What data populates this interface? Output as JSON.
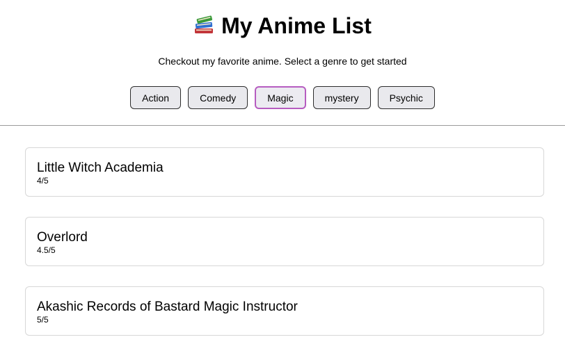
{
  "header": {
    "title": "My Anime List",
    "icon": "books-icon",
    "subtitle": "Checkout my favorite anime. Select a genre to get started"
  },
  "genres": {
    "selected": "Magic",
    "items": [
      {
        "label": "Action"
      },
      {
        "label": "Comedy"
      },
      {
        "label": "Magic"
      },
      {
        "label": "mystery"
      },
      {
        "label": "Psychic"
      }
    ]
  },
  "anime": [
    {
      "title": "Little Witch Academia",
      "rating": "4/5"
    },
    {
      "title": "Overlord",
      "rating": "4.5/5"
    },
    {
      "title": "Akashic Records of Bastard Magic Instructor",
      "rating": "5/5"
    }
  ],
  "colors": {
    "active_border": "#b65cc0",
    "button_bg": "#e9e9ed",
    "card_border": "#d7d7d7",
    "divider": "#9a9a9a"
  }
}
